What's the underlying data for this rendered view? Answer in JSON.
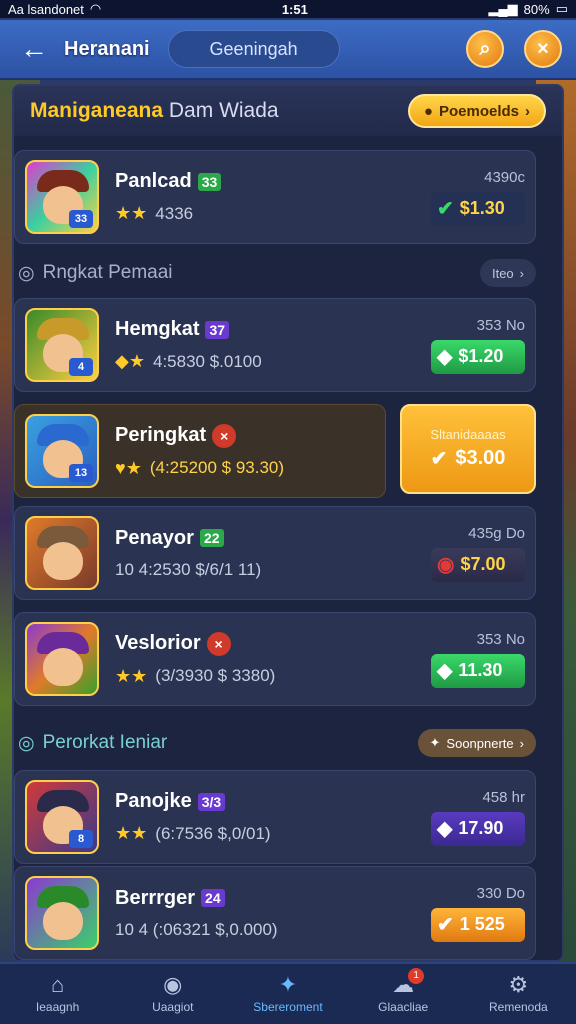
{
  "status_bar": {
    "carrier": "Aa lsandonet",
    "time": "1:51",
    "battery": "80%"
  },
  "header": {
    "title": "Heranani",
    "tab": "Geeningah",
    "search_icon": "search-icon",
    "close_label": "×"
  },
  "panel": {
    "title_part1": "Maniganeana",
    "title_part2": "Dam Wiada",
    "promo_label": "Poemoelds"
  },
  "cards_top": [
    {
      "name": "Panlcad",
      "level": "33",
      "stars": "4336",
      "price_top": "4390c",
      "price": "$1.30",
      "hat": "#7a2a1a",
      "bg": "linear-gradient(135deg,#e03ad0,#3ad0a0,#ffd040)"
    }
  ],
  "section1": {
    "title": "Rngkat Pemaai",
    "pill": "Iteo"
  },
  "cards_mid": [
    {
      "name": "Hemgkat",
      "level": "37",
      "stats": "4:5830  $.0100",
      "price_top": "353 No",
      "price": "$1.20",
      "hat": "#c89a2a",
      "bg": "linear-gradient(135deg,#3a8a2a,#ffd040)"
    },
    {
      "name": "Peringkat",
      "level": "×",
      "stats": "(4:25200  $ 93.30)",
      "big_label": "Sltanidaaaas",
      "big_price": "$3.00",
      "hat": "#2a6ad0",
      "bg": "linear-gradient(135deg,#3aa0e0,#2a60c0)"
    },
    {
      "name": "Penayor",
      "level": "22",
      "stats": "10 4:2530  $/6/1 11)",
      "price_top": "435g Do",
      "price": "$7.00",
      "hat": "#7a5a3a",
      "bg": "linear-gradient(135deg,#e07a2a,#7a3a2a)"
    },
    {
      "name": "Veslorior",
      "level": "×",
      "stats": "(3/3930  $ 3380)",
      "price_top": "353 No",
      "price": "11.30",
      "hat": "#6a2a9a",
      "bg": "linear-gradient(135deg,#8a3ad0,#e07a2a,#3aa02a)"
    }
  ],
  "section2": {
    "title": "Perorkat Ieniar",
    "pill": "Soonpnerte"
  },
  "cards_bottom": [
    {
      "name": "Panojke",
      "level": "3/3",
      "stats": "(6:7536  $,0/01)",
      "price_top": "458 hr",
      "price": "17.90",
      "hat": "#2a2a4a",
      "bg": "linear-gradient(135deg,#d03a3a,#3a3a8a)"
    },
    {
      "name": "Berrrger",
      "level": "24",
      "stats": "10 4 (:06321  $,0.000)",
      "price_top": "330 Do",
      "price": "1 525",
      "hat": "#2a8a2a",
      "bg": "linear-gradient(135deg,#8a3ad0,#3ad06a)"
    }
  ],
  "nav": [
    {
      "label": "Ieaagnh",
      "icon": "home-icon"
    },
    {
      "label": "Uaagiot",
      "icon": "profile-icon"
    },
    {
      "label": "Sbereroment",
      "icon": "store-icon"
    },
    {
      "label": "Glaacliae",
      "icon": "chat-icon",
      "badge": "1"
    },
    {
      "label": "Remenoda",
      "icon": "settings-icon"
    }
  ]
}
